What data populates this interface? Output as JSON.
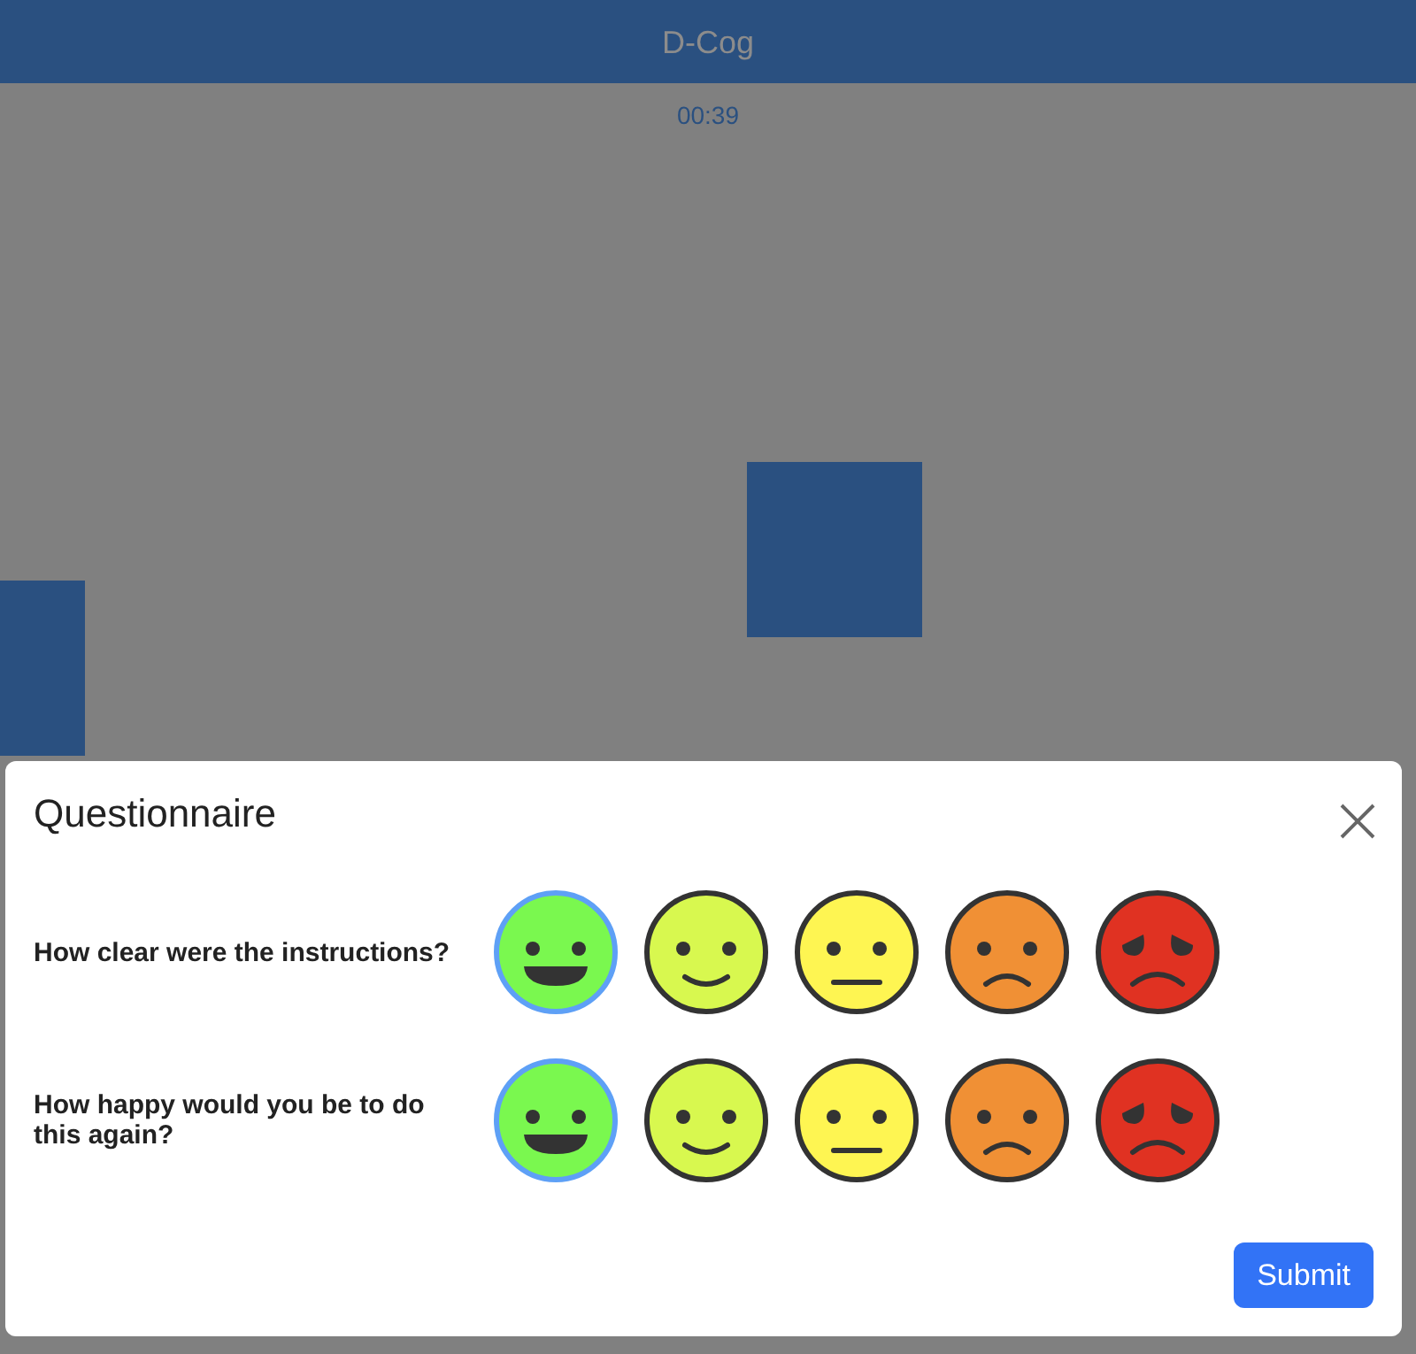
{
  "header": {
    "title": "D-Cog"
  },
  "timer": "00:39",
  "questionnaire": {
    "title": "Questionnaire",
    "questions": [
      {
        "text": "How clear were the instructions?",
        "options": [
          {
            "kind": "grin",
            "color": "#7af84f",
            "selected": true
          },
          {
            "kind": "smile",
            "color": "#d8f84f",
            "selected": false
          },
          {
            "kind": "neutral",
            "color": "#fef552",
            "selected": false
          },
          {
            "kind": "frown",
            "color": "#f09035",
            "selected": false
          },
          {
            "kind": "worried",
            "color": "#e03222",
            "selected": false
          }
        ]
      },
      {
        "text": "How happy would you be to do this again?",
        "options": [
          {
            "kind": "grin",
            "color": "#7af84f",
            "selected": true
          },
          {
            "kind": "smile",
            "color": "#d8f84f",
            "selected": false
          },
          {
            "kind": "neutral",
            "color": "#fef552",
            "selected": false
          },
          {
            "kind": "frown",
            "color": "#f09035",
            "selected": false
          },
          {
            "kind": "worried",
            "color": "#e03222",
            "selected": false
          }
        ]
      }
    ],
    "submit": "Submit"
  }
}
